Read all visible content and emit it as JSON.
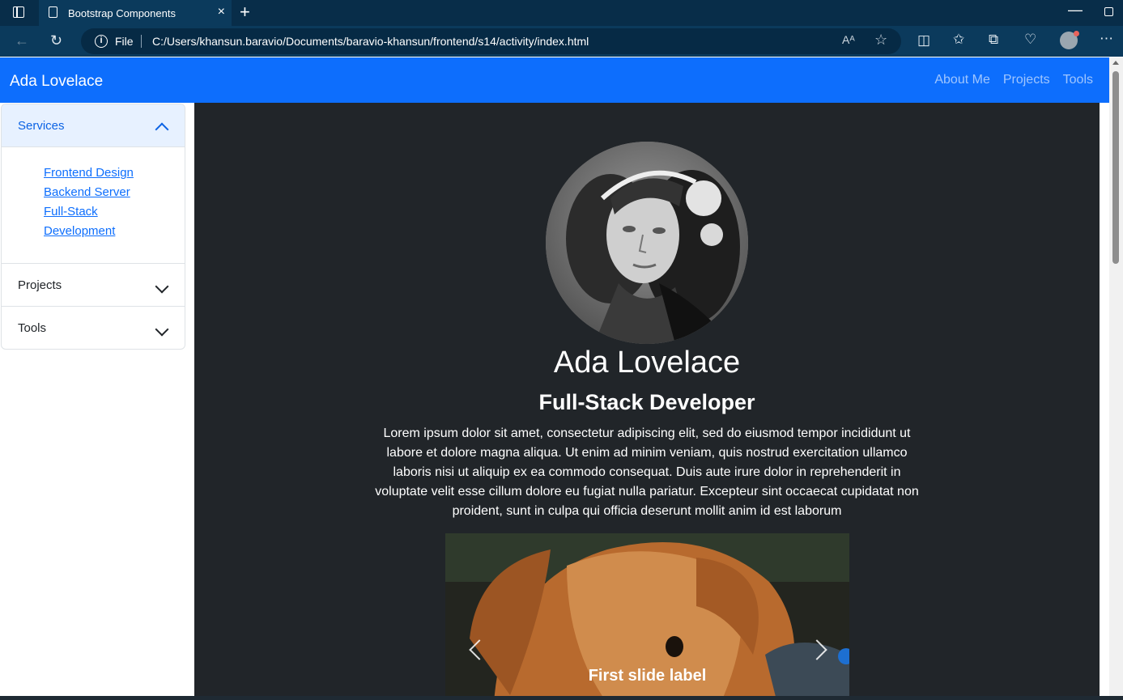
{
  "browser": {
    "tab_title": "Bootstrap Components",
    "tab_close": "×",
    "new_tab": "+",
    "minimize": "—",
    "address_label": "File",
    "url": "C:/Users/khansun.baravio/Documents/baravio-khansun/frontend/s14/activity/index.html",
    "read_aloud": "Aᴬ"
  },
  "navbar": {
    "brand": "Ada Lovelace",
    "links": [
      "About Me",
      "Projects",
      "Tools"
    ]
  },
  "sidebar": {
    "sections": [
      {
        "label": "Services",
        "expanded": true,
        "items": [
          "Frontend Design",
          "Backend Server",
          "Full-Stack Development"
        ]
      },
      {
        "label": "Projects",
        "expanded": false
      },
      {
        "label": "Tools",
        "expanded": false
      }
    ]
  },
  "main": {
    "name": "Ada Lovelace",
    "role": "Full-Stack Developer",
    "bio": "Lorem ipsum dolor sit amet, consectetur adipiscing elit, sed do eiusmod tempor incididunt ut labore et dolore magna aliqua. Ut enim ad minim veniam, quis nostrud exercitation ullamco laboris nisi ut aliquip ex ea commodo consequat. Duis aute irure dolor in reprehenderit in voluptate velit esse cillum dolore eu fugiat nulla pariatur. Excepteur sint occaecat cupidatat non proident, sunt in culpa qui officia deserunt mollit anim id est laborum",
    "carousel": {
      "caption": "First slide label"
    }
  },
  "colors": {
    "primary": "#0d6efd",
    "dark_bg": "#212529",
    "browser_bg": "#082d49"
  }
}
